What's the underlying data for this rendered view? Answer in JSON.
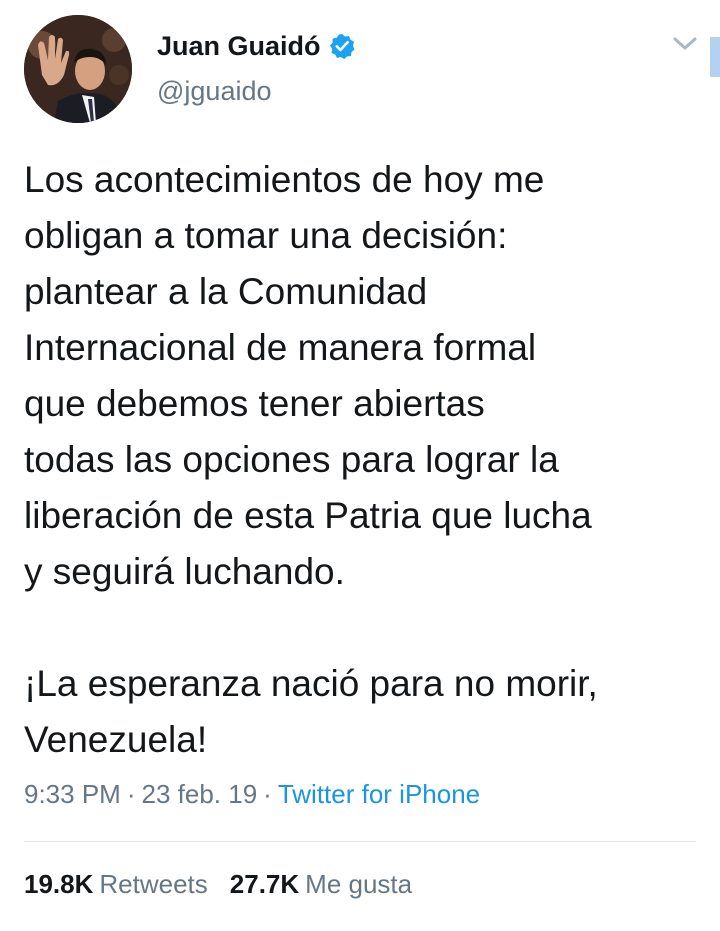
{
  "author": {
    "display_name": "Juan Guaidó",
    "handle": "@jguaido",
    "verified": true,
    "avatar": "profile-photo"
  },
  "tweet": {
    "text": "Los acontecimientos de hoy me\nobligan a tomar una decisión:\nplantear a la Comunidad\nInternacional de manera formal\nque debemos tener abiertas\ntodas las opciones para lograr la\nliberación de esta Patria que lucha\ny seguirá luchando.\n\n¡La esperanza nació para no morir,\nVenezuela!",
    "time": "9:33 PM",
    "date": "23 feb. 19",
    "separator": "·",
    "source": "Twitter for iPhone"
  },
  "stats": {
    "retweets_count": "19.8K",
    "retweets_label": "Retweets",
    "likes_count": "27.7K",
    "likes_label": "Me gusta"
  },
  "icons": {
    "verified": "verified-badge-icon",
    "menu": "chevron-down-icon"
  },
  "colors": {
    "text": "#14171a",
    "secondary": "#657786",
    "link": "#1b95e0",
    "verified": "#1da1f2",
    "divider": "#e1e8ed"
  }
}
